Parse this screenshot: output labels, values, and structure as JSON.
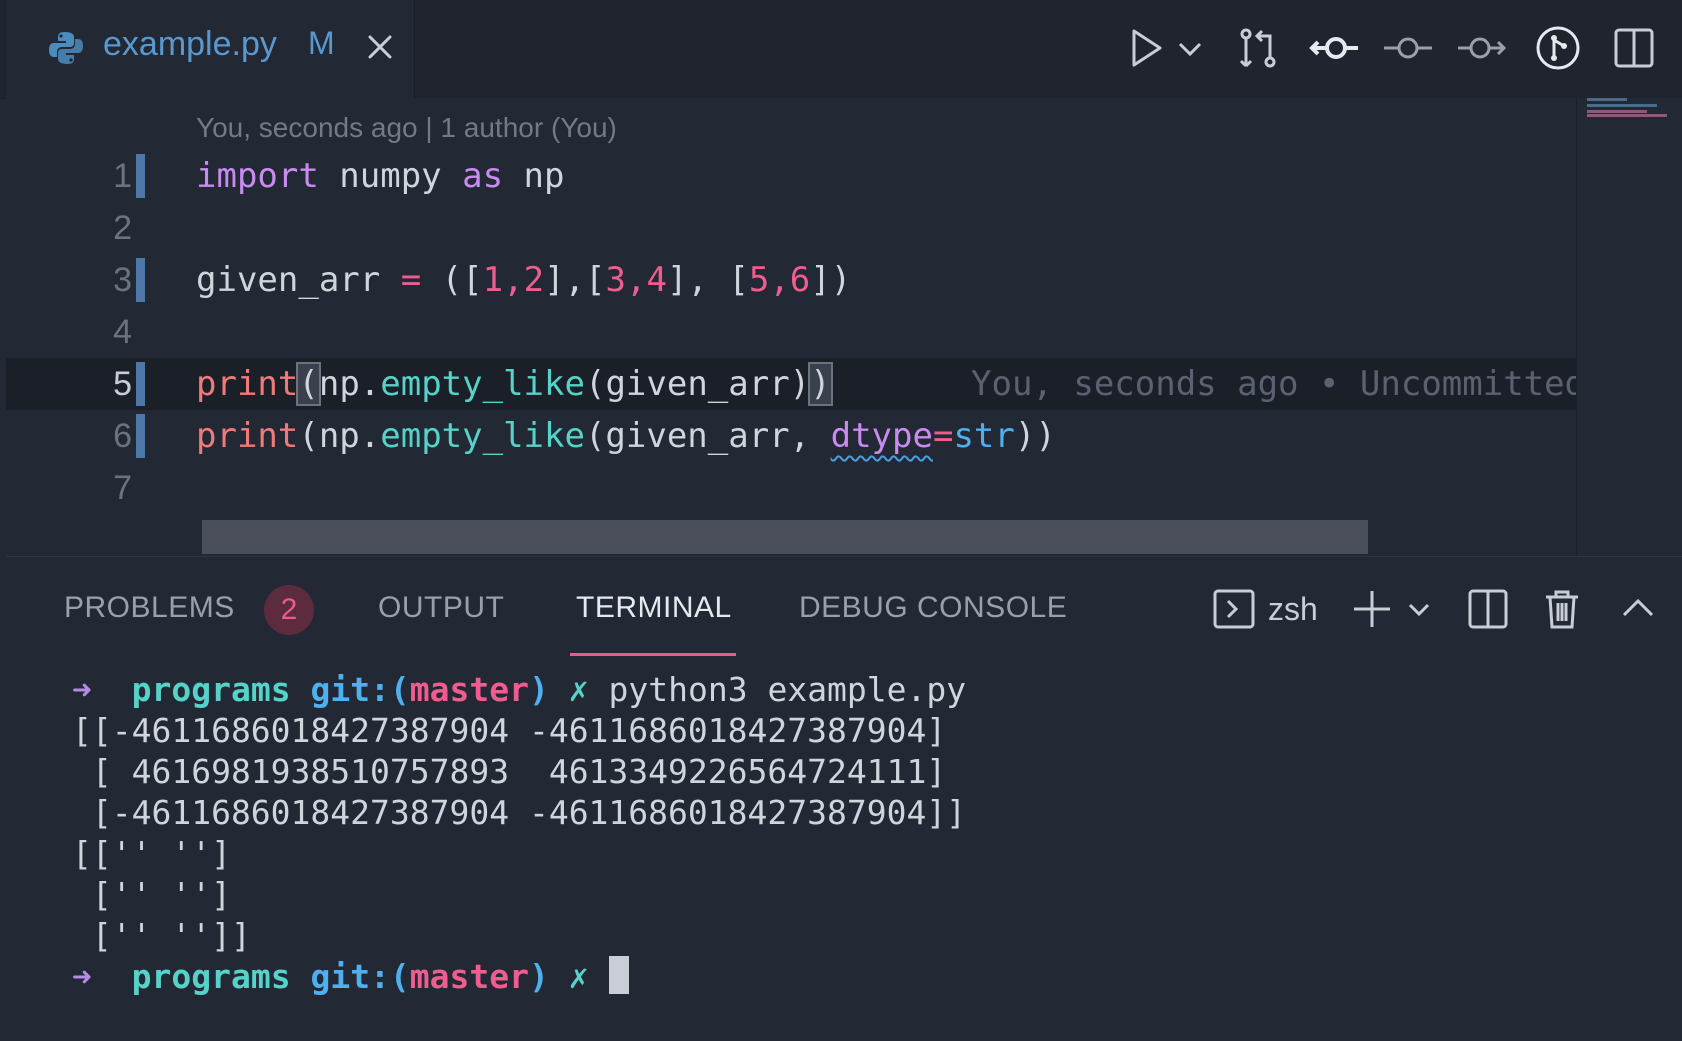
{
  "tab": {
    "filename": "example.py",
    "status": "M",
    "file_icon": "python-icon"
  },
  "toolbar": {
    "icons": [
      "play-icon",
      "chevron-down-icon",
      "compare-changes-icon",
      "previous-commit-icon",
      "git-commit-icon",
      "next-commit-icon",
      "git-graph-icon",
      "split-editor-icon"
    ]
  },
  "editor": {
    "blame_header": "You, seconds ago | 1 author (You)",
    "line_numbers": [
      "1",
      "2",
      "3",
      "4",
      "5",
      "6",
      "7"
    ],
    "inline_blame": "You, seconds ago • Uncommitted",
    "lines": {
      "l1": {
        "kw1": "import",
        "t1": " numpy ",
        "kw2": "as",
        "t2": " np"
      },
      "l3": {
        "t1": "given_arr ",
        "op": "=",
        "t2": " ([",
        "n1": "1",
        "c1": ",",
        "n2": "2",
        "t3": "],[",
        "n3": "3",
        "c2": ",",
        "n4": "4",
        "t4": "], [",
        "n5": "5",
        "c3": ",",
        "n6": "6",
        "t5": "])"
      },
      "l5": {
        "fn1": "print",
        "p1": "(",
        "t1": "np.",
        "fn2": "empty_like",
        "t2": "(given_arr)",
        "p2": ")"
      },
      "l6": {
        "fn1": "print",
        "t1": "(np.",
        "fn2": "empty_like",
        "t2": "(given_arr, ",
        "param": "dtype",
        "eq": "=",
        "type": "str",
        "t3": "))"
      }
    }
  },
  "panel": {
    "tabs": {
      "problems": "PROBLEMS",
      "output": "OUTPUT",
      "terminal": "TERMINAL",
      "debug": "DEBUG CONSOLE"
    },
    "problems_count": "2",
    "shell": "zsh",
    "terminal": {
      "prompt_arrow": "➜",
      "dir": "programs",
      "git_label": "git:(",
      "branch": "master",
      "git_close": ")",
      "dirty": "✗",
      "command": "python3 example.py",
      "output": [
        "[[-4611686018427387904 -4611686018427387904]",
        " [ 4616981938510757893  4613349226564724111]",
        " [-4611686018427387904 -4611686018427387904]]",
        "[['' '']",
        " ['' '']",
        " ['' '']]"
      ]
    }
  }
}
